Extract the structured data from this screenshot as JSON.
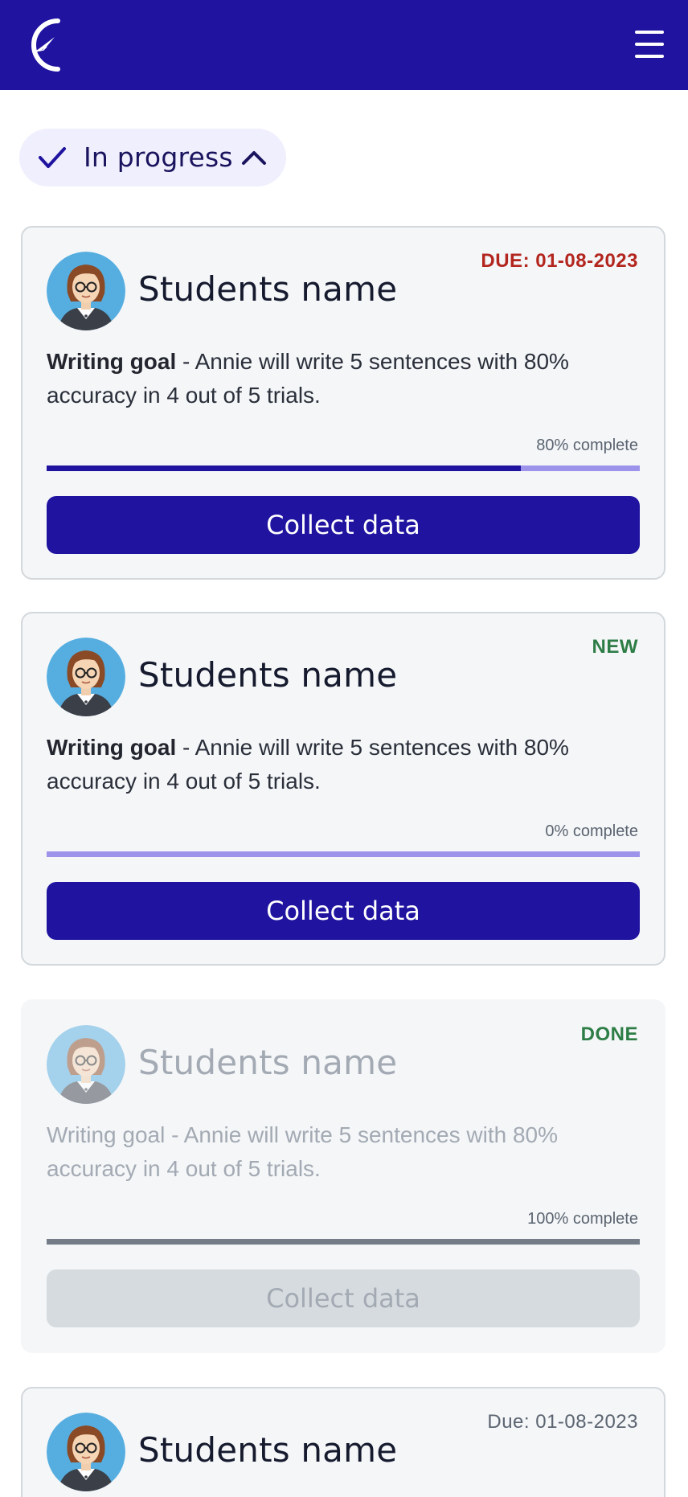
{
  "header": {
    "logo_icon": "compass-logo-icon",
    "menu_icon": "hamburger-menu-icon",
    "bar_color": "#1f13a0"
  },
  "filter": {
    "label": "In progress",
    "check_icon": "check-icon",
    "chevron_icon": "chevron-up-icon"
  },
  "cards": [
    {
      "student_name": "Students name",
      "status": "DUE: 01-08-2023",
      "goal_title": "Writing goal",
      "goal_text": " - Annie will write 5 sentences with 80% accuracy in 4 out of 5 trials.",
      "progress_label": "80% complete",
      "progress": 0.8,
      "button_label": "Collect data"
    },
    {
      "student_name": "Students name",
      "status": "NEW",
      "goal_title": "Writing goal",
      "goal_text": " - Annie will write 5 sentences with 80% accuracy in 4 out of 5 trials.",
      "progress_label": "0% complete",
      "progress": 0.0,
      "button_label": "Collect data"
    },
    {
      "student_name": "Students name",
      "status": "DONE",
      "goal_title": "Writing goal",
      "goal_text": " - Annie will write 5 sentences with 80% accuracy in 4 out of 5 trials.",
      "progress_label": "100% complete",
      "progress": 1.0,
      "button_label": "Collect data"
    },
    {
      "student_name": "Students name",
      "status": "Due: 01-08-2023"
    }
  ],
  "colors": {
    "primary": "#1f13a0",
    "progress_track": "#9d93ea",
    "due": "#b3261e",
    "new": "#2e7d46",
    "disabled": "#d6dbdf"
  }
}
